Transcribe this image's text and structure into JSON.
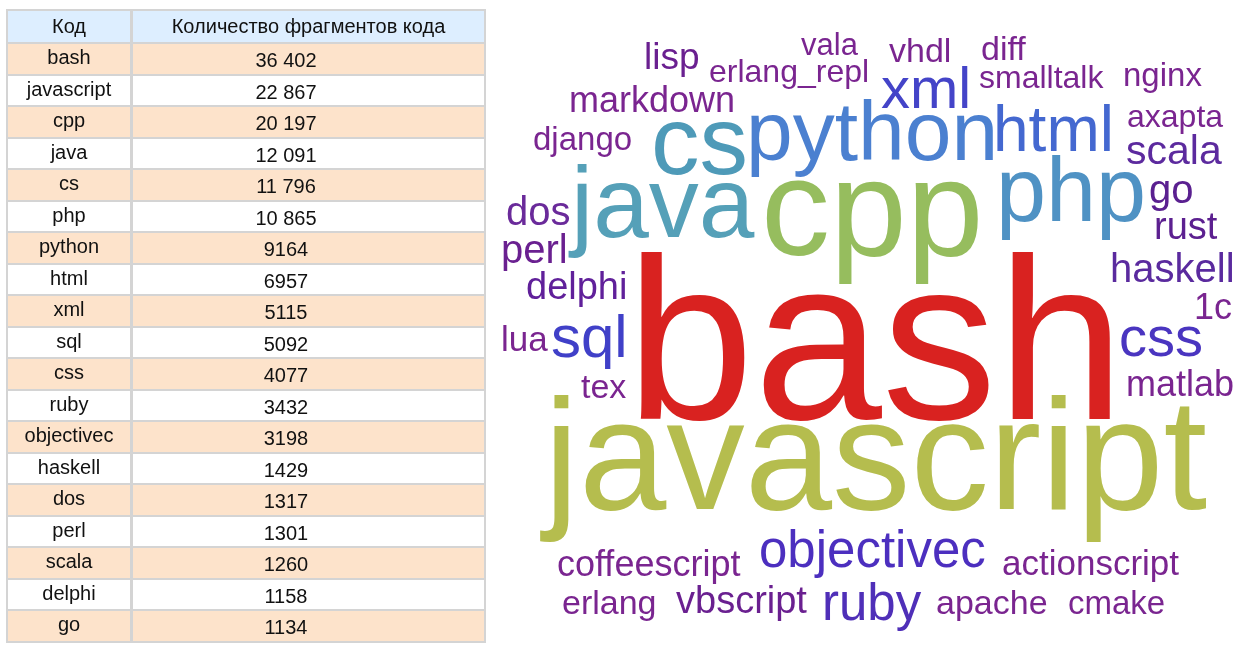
{
  "table": {
    "columns": [
      "Код",
      "Количество фрагментов кода"
    ],
    "rows": [
      {
        "code": "bash",
        "count": "36 402"
      },
      {
        "code": "javascript",
        "count": "22 867"
      },
      {
        "code": "cpp",
        "count": "20 197"
      },
      {
        "code": "java",
        "count": "12 091"
      },
      {
        "code": "cs",
        "count": "11 796"
      },
      {
        "code": "php",
        "count": "10 865"
      },
      {
        "code": "python",
        "count": "9164"
      },
      {
        "code": "html",
        "count": "6957"
      },
      {
        "code": "xml",
        "count": "5115"
      },
      {
        "code": "sql",
        "count": "5092"
      },
      {
        "code": "css",
        "count": "4077"
      },
      {
        "code": "ruby",
        "count": "3432"
      },
      {
        "code": "objectivec",
        "count": "3198"
      },
      {
        "code": "haskell",
        "count": "1429"
      },
      {
        "code": "dos",
        "count": "1317"
      },
      {
        "code": "perl",
        "count": "1301"
      },
      {
        "code": "scala",
        "count": "1260"
      },
      {
        "code": "delphi",
        "count": "1158"
      },
      {
        "code": "go",
        "count": "1134"
      }
    ]
  },
  "word_cloud": {
    "words": [
      {
        "text": "lisp",
        "color": "#6a2090"
      },
      {
        "text": "vala",
        "color": "#7a2590"
      },
      {
        "text": "vhdl",
        "color": "#7a2590"
      },
      {
        "text": "diff",
        "color": "#7a2590"
      },
      {
        "text": "erlang_repl",
        "color": "#7a2590"
      },
      {
        "text": "xml",
        "color": "#4444c8"
      },
      {
        "text": "smalltalk",
        "color": "#7a2590"
      },
      {
        "text": "nginx",
        "color": "#7a2590"
      },
      {
        "text": "markdown",
        "color": "#7a2590"
      },
      {
        "text": "django",
        "color": "#7a2590"
      },
      {
        "text": "cs",
        "color": "#4e9ab8"
      },
      {
        "text": "python",
        "color": "#4b80d0"
      },
      {
        "text": "html",
        "color": "#4468d0"
      },
      {
        "text": "axapta",
        "color": "#7a2590"
      },
      {
        "text": "scala",
        "color": "#5c2a9e"
      },
      {
        "text": "java",
        "color": "#55a0b8"
      },
      {
        "text": "cpp",
        "color": "#96bd5e"
      },
      {
        "text": "php",
        "color": "#4f92c4"
      },
      {
        "text": "go",
        "color": "#5a2090"
      },
      {
        "text": "dos",
        "color": "#6a2a9a"
      },
      {
        "text": "rust",
        "color": "#5c2090"
      },
      {
        "text": "perl",
        "color": "#6a2090"
      },
      {
        "text": "delphi",
        "color": "#60209a"
      },
      {
        "text": "lua",
        "color": "#7a2590"
      },
      {
        "text": "sql",
        "color": "#4040c8"
      },
      {
        "text": "tex",
        "color": "#7a2590"
      },
      {
        "text": "bash",
        "color": "#d92220"
      },
      {
        "text": "haskell",
        "color": "#5a2a9e"
      },
      {
        "text": "1c",
        "color": "#7a2590"
      },
      {
        "text": "css",
        "color": "#4a35c0"
      },
      {
        "text": "matlab",
        "color": "#7a2590"
      },
      {
        "text": "javascript",
        "color": "#b5bd4e"
      },
      {
        "text": "coffeescript",
        "color": "#7a2590"
      },
      {
        "text": "objectivec",
        "color": "#4c2fbf"
      },
      {
        "text": "actionscript",
        "color": "#7a2590"
      },
      {
        "text": "erlang",
        "color": "#7a2590"
      },
      {
        "text": "vbscript",
        "color": "#6a2090"
      },
      {
        "text": "ruby",
        "color": "#4f2fb8"
      },
      {
        "text": "apache",
        "color": "#7a2590"
      },
      {
        "text": "cmake",
        "color": "#7a2590"
      }
    ]
  }
}
